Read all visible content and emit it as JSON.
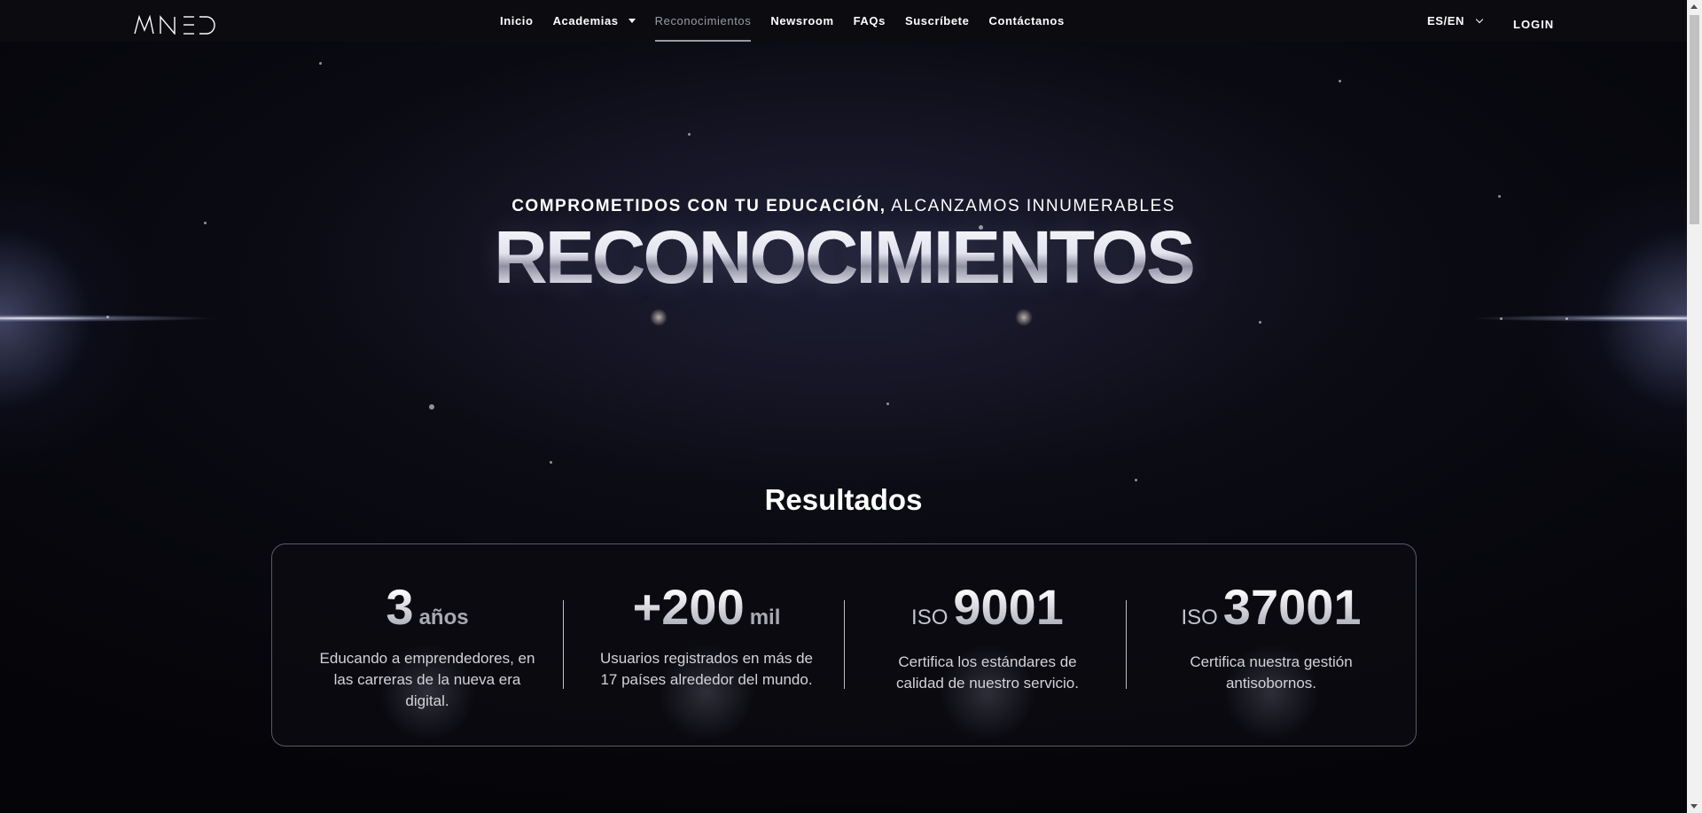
{
  "nav": {
    "logo_text": "MNED",
    "items": [
      {
        "label": "Inicio",
        "active": false
      },
      {
        "label": "Academias",
        "active": false,
        "has_dropdown": true
      },
      {
        "label": "Reconocimientos",
        "active": true
      },
      {
        "label": "Newsroom",
        "active": false
      },
      {
        "label": "FAQs",
        "active": false
      },
      {
        "label": "Suscríbete",
        "active": false
      },
      {
        "label": "Contáctanos",
        "active": false
      }
    ],
    "language": "ES/EN",
    "login": "LOGIN"
  },
  "hero": {
    "subtitle_bold": "COMPROMETIDOS CON TU EDUCACIÓN,",
    "subtitle_rest": " ALCANZAMOS INNUMERABLES",
    "title": "RECONOCIMIENTOS"
  },
  "results": {
    "title": "Resultados",
    "stats": [
      {
        "prefix": "",
        "number": "3",
        "unit": "años",
        "description": "Educando a emprendedores, en las carreras de la nueva era digital."
      },
      {
        "prefix": "",
        "number": "+200",
        "unit": "mil",
        "description": "Usuarios registrados en más de 17 países alrededor del mundo."
      },
      {
        "prefix": "ISO",
        "number": "9001",
        "unit": "",
        "description": "Certifica los estándares de calidad de nuestro servicio."
      },
      {
        "prefix": "ISO",
        "number": "37001",
        "unit": "",
        "description": "Certifica nuestra gestión antisobornos."
      }
    ]
  },
  "colors": {
    "background": "#07070d",
    "nav_background": "#0b0b10",
    "active_nav": "#9a9aa6",
    "card_border": "#5a5a66"
  }
}
